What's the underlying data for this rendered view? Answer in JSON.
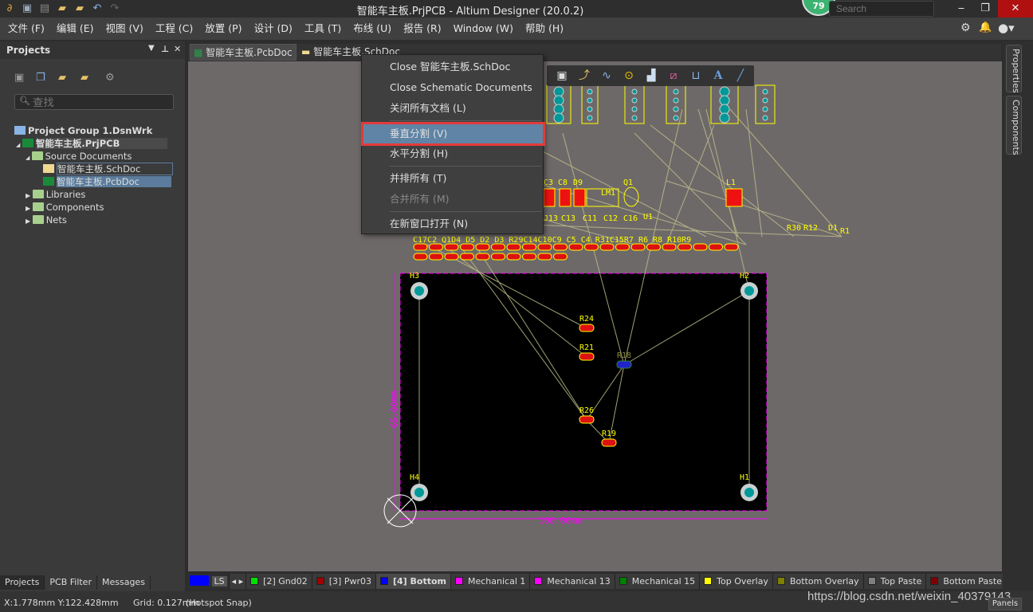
{
  "window": {
    "title": "智能车主板.PrjPCB - Altium Designer (20.0.2)",
    "badge": "79",
    "search_placeholder": "Search",
    "minimize": "‒",
    "restore": "❐",
    "close": "✕"
  },
  "menu": [
    "文件 (F)",
    "编辑 (E)",
    "视图 (V)",
    "工程 (C)",
    "放置 (P)",
    "设计 (D)",
    "工具 (T)",
    "布线 (U)",
    "报告 (R)",
    "Window (W)",
    "帮助 (H)"
  ],
  "projects_panel": {
    "title": "Projects",
    "search_placeholder": "查找",
    "tree": [
      {
        "label": "Project Group 1.DsnWrk"
      },
      {
        "label": "智能车主板.PrjPCB"
      },
      {
        "label": "Source Documents"
      },
      {
        "label": "智能车主板.SchDoc"
      },
      {
        "label": "智能车主板.PcbDoc"
      },
      {
        "label": "Libraries"
      },
      {
        "label": "Components"
      },
      {
        "label": "Nets"
      }
    ],
    "bottom_tabs": [
      "Projects",
      "PCB Filter",
      "Messages"
    ]
  },
  "doc_tabs": [
    {
      "label": "智能车主板.PcbDoc",
      "active": true
    },
    {
      "label": "智能车主板.SchDoc",
      "active": false
    }
  ],
  "context_menu": {
    "items": [
      {
        "label": "Close 智能车主板.SchDoc"
      },
      {
        "label": "Close Schematic Documents"
      },
      {
        "label": "关闭所有文档 (L)"
      },
      {
        "label": "垂直分割 (V)",
        "highlighted": true
      },
      {
        "label": "水平分割 (H)"
      },
      {
        "label": "并排所有 (T)"
      },
      {
        "label": "合并所有 (M)",
        "disabled": true
      },
      {
        "label": "在新窗口打开 (N)"
      }
    ]
  },
  "right_panels": [
    "Properties",
    "Components"
  ],
  "pcb": {
    "board_width": "100.00mm",
    "board_height": "65.00mm",
    "holes": [
      "H3",
      "H2",
      "H4",
      "H1"
    ],
    "resistors": [
      "R24",
      "R21",
      "R18",
      "R26",
      "R19"
    ],
    "top_labels": [
      "C3",
      "C8",
      "D9",
      "LM1",
      "Q1",
      "L1",
      "J13",
      "C13",
      "C11",
      "C12",
      "C16",
      "U1",
      "R30",
      "R12",
      "D1",
      "R1"
    ],
    "row_labels": "C17C2 Q1D4 D5 D2 D3 R29C14C10C9 C5 C4 R31C15R7 R6 R8 R10R9"
  },
  "layers": {
    "current_swatch_label": "LS",
    "tabs": [
      {
        "label": "[2] Gnd02",
        "color": "#00e000"
      },
      {
        "label": "[3] Pwr03",
        "color": "#a00000"
      },
      {
        "label": "[4] Bottom",
        "color": "#0000ff",
        "active": true
      },
      {
        "label": "Mechanical 1",
        "color": "#ff00ff"
      },
      {
        "label": "Mechanical 13",
        "color": "#ff00ff"
      },
      {
        "label": "Mechanical 15",
        "color": "#008000"
      },
      {
        "label": "Top Overlay",
        "color": "#ffff00"
      },
      {
        "label": "Bottom Overlay",
        "color": "#808000"
      },
      {
        "label": "Top Paste",
        "color": "#808080"
      },
      {
        "label": "Bottom Paste",
        "color": "#800000"
      }
    ]
  },
  "status": {
    "coords": "X:1.778mm Y:122.428mm",
    "grid": "Grid: 0.127mm",
    "snap": "(Hotspot Snap)",
    "panels": "Panels"
  },
  "watermark": "https://blog.csdn.net/weixin_40379143",
  "colors": {
    "accent_highlight": "#5f84a5",
    "highlight_border": "#e23b3b",
    "board": "#000000",
    "outline": "#ff00ff",
    "silk": "#ffff00",
    "ratsnest": "#bdbd8a"
  }
}
